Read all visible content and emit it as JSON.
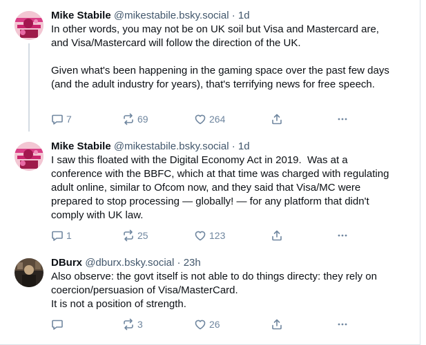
{
  "posts": [
    {
      "author_name": "Mike Stabile",
      "author_handle": "@mikestabile.bsky.social",
      "separator": "·",
      "time": "1d",
      "text": "In other words, you may not be on UK soil but Visa and Mastercard are, and Visa/Mastercard will follow the direction of the UK.\n\nGiven what's been happening in the gaming space over the past few days (and the adult industry for years), that's terrifying news for free speech.",
      "replies": "7",
      "reposts": "69",
      "likes": "264"
    },
    {
      "author_name": "Mike Stabile",
      "author_handle": "@mikestabile.bsky.social",
      "separator": "·",
      "time": "1d",
      "text": "I saw this floated with the Digital Economy Act in 2019.  Was at a conference with the BBFC, which at that time was charged with regulating adult online, similar to Ofcom now, and they said that Visa/MC were prepared to stop processing — globally! — for any platform that didn't comply with UK law.",
      "replies": "1",
      "reposts": "25",
      "likes": "123"
    },
    {
      "author_name": "DBurx",
      "author_handle": "@dburx.bsky.social",
      "separator": "·",
      "time": "23h",
      "text": "Also observe: the govt itself is not able to do things directy: they rely on coercion/persuasion of Visa/MasterCard.\nIt is not a position of strength.",
      "replies": "",
      "reposts": "3",
      "likes": "26"
    }
  ],
  "icons": {
    "reply": "reply-icon",
    "repost": "repost-icon",
    "like": "heart-icon",
    "share": "share-icon",
    "more": "more-icon"
  },
  "colors": {
    "action_gray": "#6f869f",
    "handle_gray": "#42576c",
    "thread_line": "#d4dbe2"
  }
}
